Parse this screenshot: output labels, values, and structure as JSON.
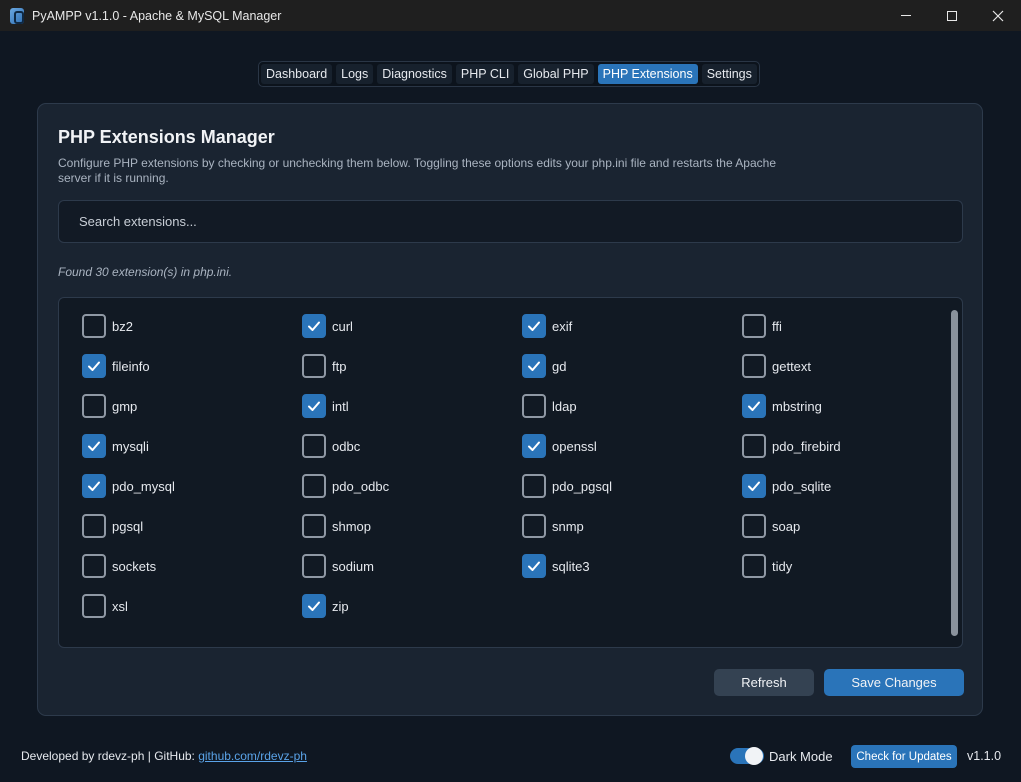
{
  "window": {
    "title": "PyAMPP v1.1.0 - Apache & MySQL Manager"
  },
  "tabs": [
    {
      "label": "Dashboard",
      "active": false
    },
    {
      "label": "Logs",
      "active": false
    },
    {
      "label": "Diagnostics",
      "active": false
    },
    {
      "label": "PHP CLI",
      "active": false
    },
    {
      "label": "Global PHP",
      "active": false
    },
    {
      "label": "PHP Extensions",
      "active": true
    },
    {
      "label": "Settings",
      "active": false
    }
  ],
  "panel": {
    "title": "PHP Extensions Manager",
    "description": "Configure PHP extensions by checking or unchecking them below. Toggling these options edits your php.ini file and restarts the Apache server if it is running.",
    "search_placeholder": "Search extensions...",
    "search_value": "",
    "found_text": "Found 30 extension(s) in php.ini."
  },
  "extensions": [
    {
      "name": "bz2",
      "enabled": false
    },
    {
      "name": "curl",
      "enabled": true
    },
    {
      "name": "exif",
      "enabled": true
    },
    {
      "name": "ffi",
      "enabled": false
    },
    {
      "name": "fileinfo",
      "enabled": true
    },
    {
      "name": "ftp",
      "enabled": false
    },
    {
      "name": "gd",
      "enabled": true
    },
    {
      "name": "gettext",
      "enabled": false
    },
    {
      "name": "gmp",
      "enabled": false
    },
    {
      "name": "intl",
      "enabled": true
    },
    {
      "name": "ldap",
      "enabled": false
    },
    {
      "name": "mbstring",
      "enabled": true
    },
    {
      "name": "mysqli",
      "enabled": true
    },
    {
      "name": "odbc",
      "enabled": false
    },
    {
      "name": "openssl",
      "enabled": true
    },
    {
      "name": "pdo_firebird",
      "enabled": false
    },
    {
      "name": "pdo_mysql",
      "enabled": true
    },
    {
      "name": "pdo_odbc",
      "enabled": false
    },
    {
      "name": "pdo_pgsql",
      "enabled": false
    },
    {
      "name": "pdo_sqlite",
      "enabled": true
    },
    {
      "name": "pgsql",
      "enabled": false
    },
    {
      "name": "shmop",
      "enabled": false
    },
    {
      "name": "snmp",
      "enabled": false
    },
    {
      "name": "soap",
      "enabled": false
    },
    {
      "name": "sockets",
      "enabled": false
    },
    {
      "name": "sodium",
      "enabled": false
    },
    {
      "name": "sqlite3",
      "enabled": true
    },
    {
      "name": "tidy",
      "enabled": false
    },
    {
      "name": "xsl",
      "enabled": false
    },
    {
      "name": "zip",
      "enabled": true
    }
  ],
  "actions": {
    "refresh_label": "Refresh",
    "save_label": "Save Changes"
  },
  "footer": {
    "developed_text": "Developed by rdevz-ph | GitHub: ",
    "github_link": "github.com/rdevz-ph",
    "dark_mode_label": "Dark Mode",
    "dark_mode_on": true,
    "updates_label": "Check for Updates",
    "version": "v1.1.0"
  },
  "colors": {
    "accent": "#2a74b9",
    "background": "#0f1722",
    "panel": "#1a2431"
  },
  "icons": {
    "app": "pyampp-logo-icon",
    "minimize": "minimize-icon",
    "maximize": "maximize-icon",
    "close": "close-icon",
    "check": "checkmark-icon"
  }
}
